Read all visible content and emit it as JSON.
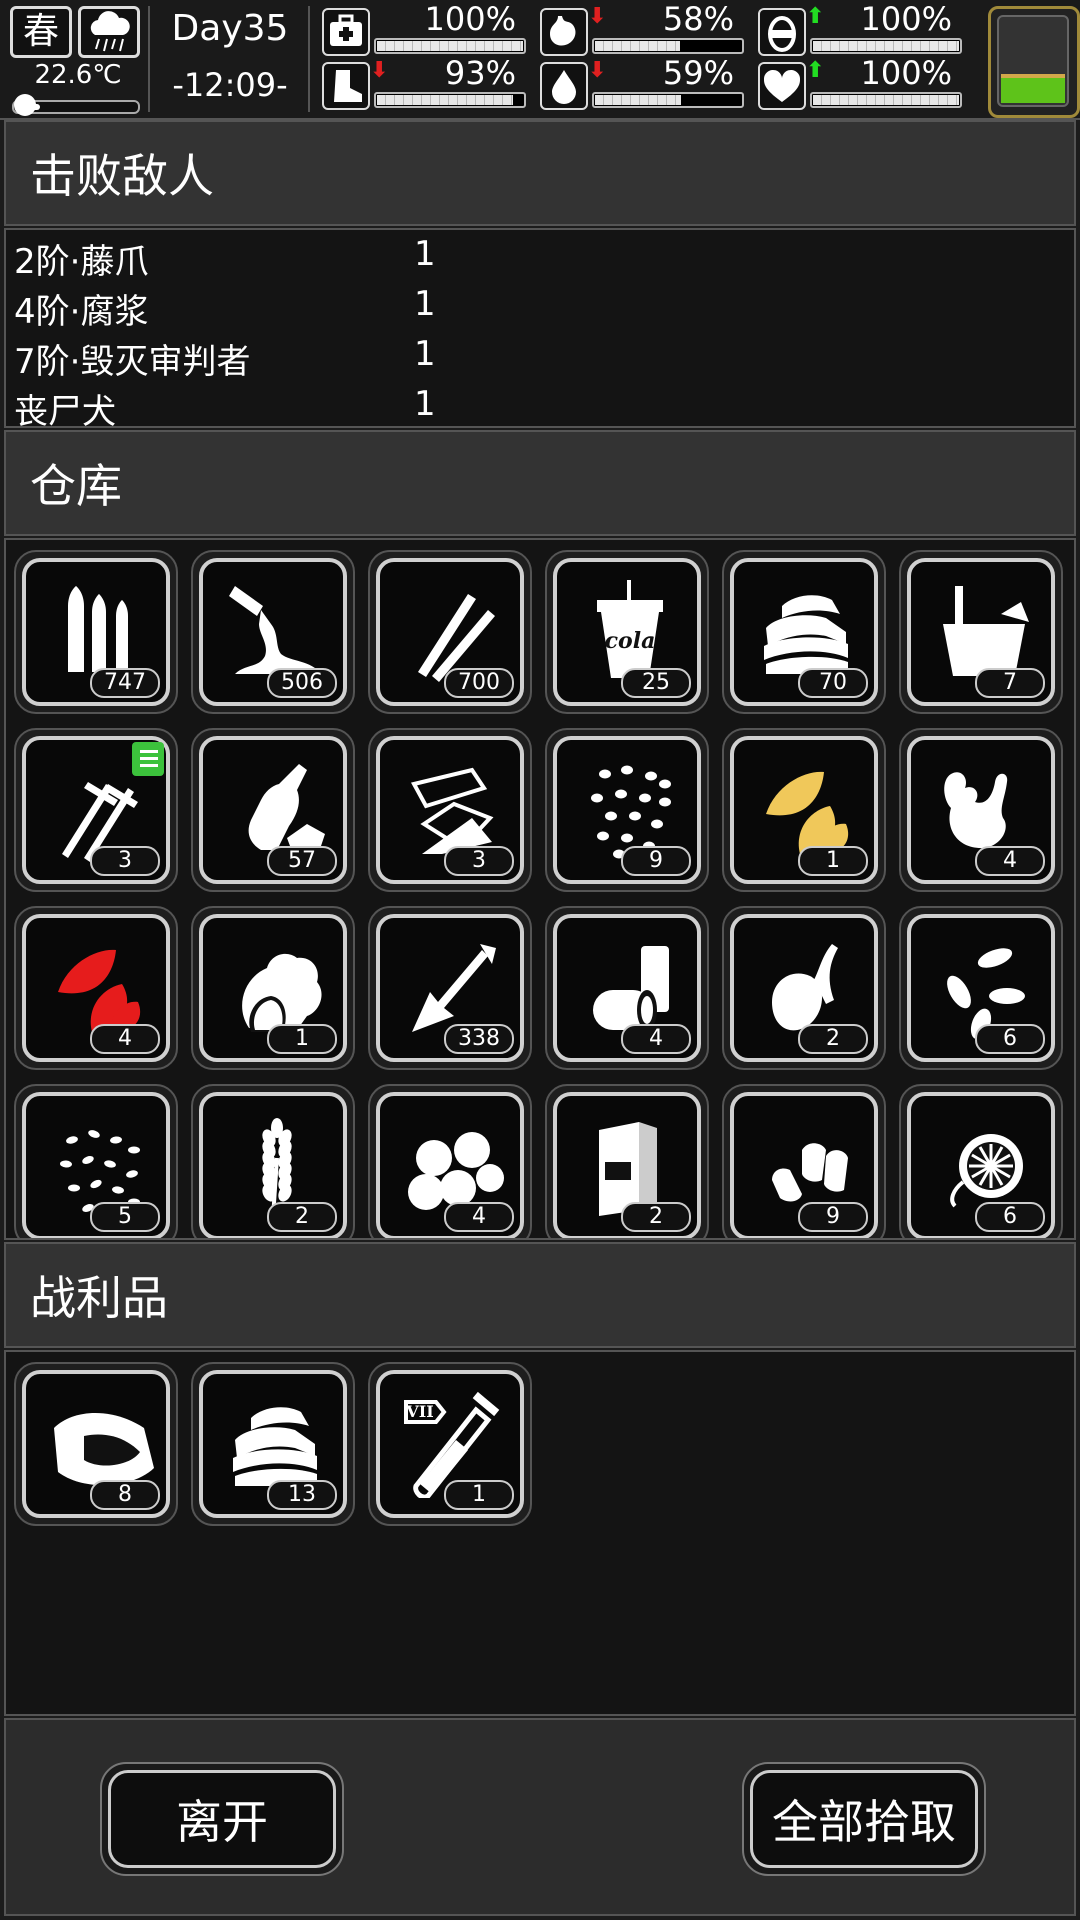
{
  "status": {
    "season": "春",
    "weather_icon": "rain-cloud-icon",
    "temperature": "22.6℃",
    "temperature_level": 0.2,
    "day": "Day35",
    "time": "-12:09-",
    "stats": [
      {
        "id": "health",
        "icon": "first-aid-kit-icon",
        "pct": "100%",
        "value": 100,
        "arrow": "",
        "arrow_color": ""
      },
      {
        "id": "hunger",
        "icon": "stomach-icon",
        "pct": "58%",
        "value": 58,
        "arrow": "⬇",
        "arrow_color": "#e02020"
      },
      {
        "id": "mood",
        "icon": "lantern-icon",
        "pct": "100%",
        "value": 100,
        "arrow": "⬆",
        "arrow_color": "#22dd22"
      },
      {
        "id": "stamina",
        "icon": "boot-icon",
        "pct": "93%",
        "value": 93,
        "arrow": "⬇",
        "arrow_color": "#e02020"
      },
      {
        "id": "thirst",
        "icon": "water-drop-icon",
        "pct": "59%",
        "value": 59,
        "arrow": "⬇",
        "arrow_color": "#e02020"
      },
      {
        "id": "spirit",
        "icon": "heart-icon",
        "pct": "100%",
        "value": 100,
        "arrow": "⬆",
        "arrow_color": "#22dd22"
      }
    ],
    "battery_level": 0.3,
    "battery_color": "#5ec31a"
  },
  "enemies_section": {
    "title": "击败敌人",
    "rows": [
      {
        "name": "2阶·藤爪",
        "count": "1"
      },
      {
        "name": "4阶·腐浆",
        "count": "1"
      },
      {
        "name": "7阶·毁灭审判者",
        "count": "1"
      },
      {
        "name": "丧尸犬",
        "count": "1"
      }
    ]
  },
  "storage_section": {
    "title": "仓库",
    "items": [
      {
        "icon": "bullets-icon",
        "count": "747"
      },
      {
        "icon": "glue-tube-icon",
        "count": "506"
      },
      {
        "icon": "pens-icon",
        "count": "700"
      },
      {
        "icon": "cola-cup-icon",
        "count": "25",
        "label": "cola"
      },
      {
        "icon": "towel-stack-icon",
        "count": "70"
      },
      {
        "icon": "bucket-icon",
        "count": "7"
      },
      {
        "icon": "screws-icon",
        "count": "3",
        "tagged": true
      },
      {
        "icon": "crumpled-bottle-icon",
        "count": "57"
      },
      {
        "icon": "paper-scraps-icon",
        "count": "3"
      },
      {
        "icon": "beans-icon",
        "count": "9"
      },
      {
        "icon": "yellow-tobacco-leaves-icon",
        "count": "1",
        "color": "#f0c85a"
      },
      {
        "icon": "ginger-root-icon",
        "count": "4"
      },
      {
        "icon": "red-tobacco-leaves-icon",
        "count": "4",
        "color": "#e61c1c"
      },
      {
        "icon": "lettuce-icon",
        "count": "1"
      },
      {
        "icon": "arrow-icon",
        "count": "338"
      },
      {
        "icon": "cans-icon",
        "count": "4"
      },
      {
        "icon": "sweet-potato-icon",
        "count": "2"
      },
      {
        "icon": "seeds-icon",
        "count": "6"
      },
      {
        "icon": "rice-grains-icon",
        "count": "5"
      },
      {
        "icon": "wheat-icon",
        "count": "2"
      },
      {
        "icon": "cotton-balls-icon",
        "count": "4"
      },
      {
        "icon": "cereal-box-icon",
        "count": "2"
      },
      {
        "icon": "sunflower-seeds-icon",
        "count": "9"
      },
      {
        "icon": "lotus-pod-icon",
        "count": "6"
      }
    ]
  },
  "loot_section": {
    "title": "战利品",
    "items": [
      {
        "icon": "sack-icon",
        "count": "8"
      },
      {
        "icon": "towel-stack-icon",
        "count": "13"
      },
      {
        "icon": "test-tube-icon",
        "count": "1",
        "label": "VII"
      }
    ]
  },
  "buttons": {
    "leave": "离开",
    "take_all": "全部拾取"
  }
}
